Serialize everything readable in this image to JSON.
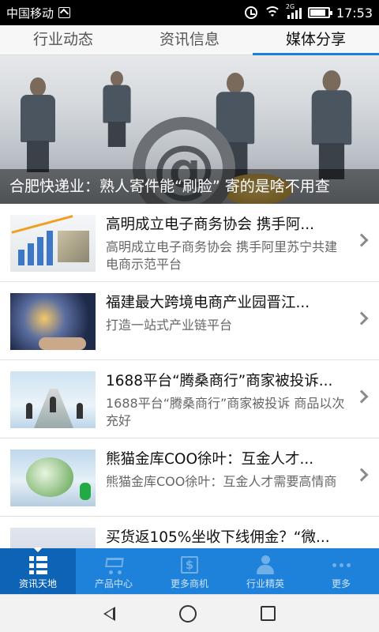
{
  "status_bar": {
    "carrier": "中国移动",
    "time": "17:53",
    "network": "2G",
    "icons": [
      "sim-icon",
      "alarm-icon",
      "wifi-icon",
      "signal-icon",
      "battery-icon"
    ]
  },
  "tabs": [
    {
      "label": "行业动态",
      "active": false
    },
    {
      "label": "资讯信息",
      "active": false
    },
    {
      "label": "媒体分享",
      "active": true
    }
  ],
  "banner": {
    "caption": "合肥快递业：熟人寄件能“刷脸” 寄的是啥不用查",
    "at_symbol": "@"
  },
  "articles": [
    {
      "title": "高明成立电子商务协会 携手阿...",
      "desc": "高明成立电子商务协会 携手阿里苏宁共建电商示范平台"
    },
    {
      "title": "福建最大跨境电商产业园晋江...",
      "desc": "打造一站式产业链平台"
    },
    {
      "title": "1688平台“腾桑商行”商家被投诉...",
      "desc": "1688平台“腾桑商行”商家被投诉 商品以次充好"
    },
    {
      "title": "熊猫金库COO徐叶：互金人才...",
      "desc": "熊猫金库COO徐叶：互金人才需要高情商"
    },
    {
      "title": "买货返105%坐收下线佣金？“微...",
      "desc": ""
    }
  ],
  "bottom_nav": [
    {
      "label": "资讯天地",
      "icon": "grid-icon",
      "active": true
    },
    {
      "label": "产品中心",
      "icon": "cart-icon",
      "active": false
    },
    {
      "label": "更多商机",
      "icon": "dollar-icon",
      "active": false
    },
    {
      "label": "行业精英",
      "icon": "person-icon",
      "active": false
    },
    {
      "label": "更多",
      "icon": "dots-icon",
      "active": false
    }
  ],
  "colors": {
    "accent": "#1e82da",
    "nav_active": "#0d63b5",
    "tab_indicator": "#1e7fd8"
  }
}
